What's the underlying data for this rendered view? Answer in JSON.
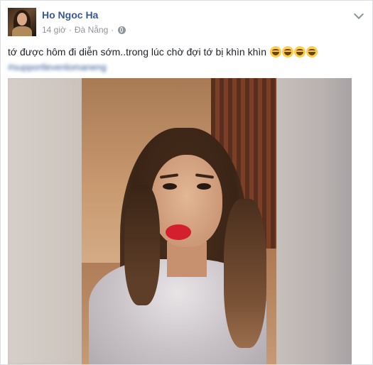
{
  "post": {
    "author": "Ho Ngoc Ha",
    "time": "14 giờ",
    "separator": "·",
    "location": "Đà Nẵng",
    "meta_dot": "·",
    "text": "tớ được hôm đi diễn sớm..trong lúc chờ đợi tớ bị khìn khìn",
    "emoji_count": 4,
    "hashtag_blurred": "#supportlevenlomaneng"
  },
  "icons": {
    "privacy": "globe-icon",
    "options": "chevron-down-icon",
    "emoji": "grinning-tears-emoji"
  },
  "colors": {
    "link": "#365899",
    "meta": "#90949c",
    "text": "#1d2129",
    "background": "#e9ebee"
  }
}
